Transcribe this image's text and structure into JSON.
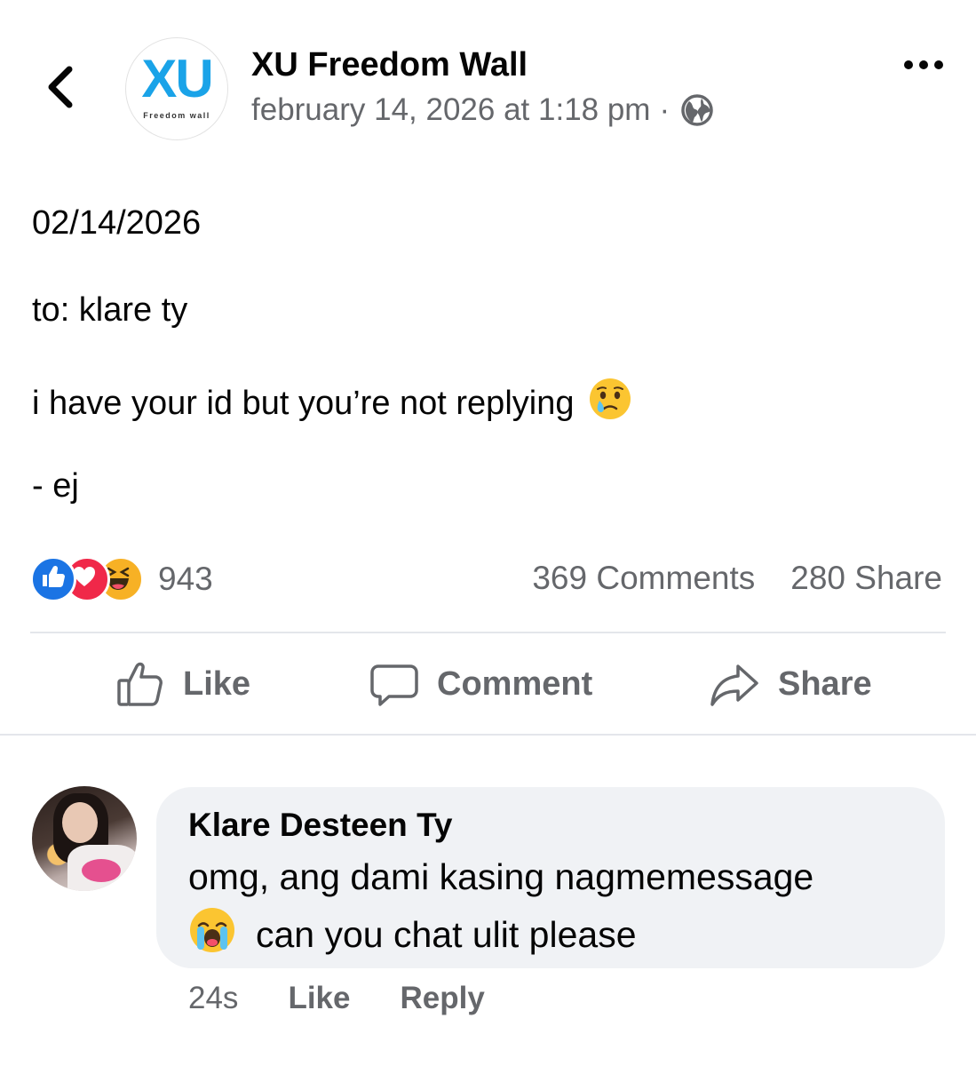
{
  "header": {
    "back_icon": "chevron-left-icon",
    "page_name": "XU Freedom Wall",
    "avatar_logo_text": "XU",
    "avatar_logo_subtitle": "Freedom wall",
    "timestamp": "february 14, 2026 at 1:18 pm",
    "separator": "·",
    "audience_icon": "globe-icon",
    "more_icon": "more-options-icon"
  },
  "post": {
    "lines": [
      "02/14/2026",
      "to: klare ty",
      "i have your id but you’re not replying",
      "- ej"
    ],
    "line_emoji": "crying-face-emoji"
  },
  "stats": {
    "reactions": [
      "like-reaction",
      "love-reaction",
      "haha-reaction"
    ],
    "reaction_count": "943",
    "comments": "369 Comments",
    "shares": "280 Share"
  },
  "actions": {
    "like": "Like",
    "comment": "Comment",
    "share": "Share"
  },
  "comment": {
    "author": "Klare Desteen Ty",
    "line1": "omg, ang dami kasing nagmemessage",
    "line2": "can you chat ulit please",
    "line2_emoji": "loudly-crying-emoji",
    "time": "24s",
    "like": "Like",
    "reply": "Reply"
  },
  "colors": {
    "text": "#050505",
    "secondary": "#65676b",
    "divider": "#e4e6eb",
    "bubble": "#f0f2f5",
    "like_blue": "#1b74e4",
    "love_red": "#f02849",
    "haha_yellow": "#f7b125",
    "logo_blue": "#1aa3e8"
  }
}
